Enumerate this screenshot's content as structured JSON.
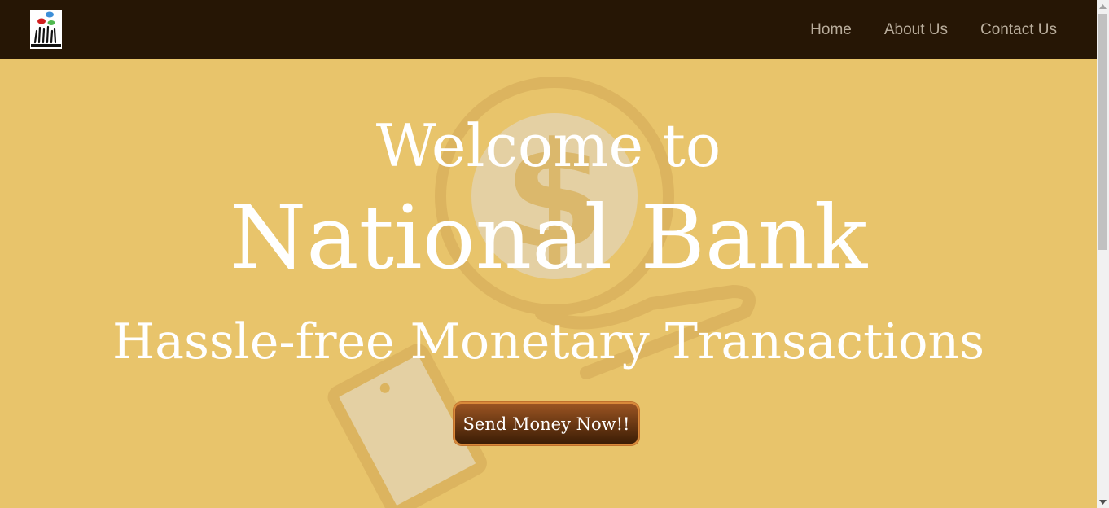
{
  "navbar": {
    "links": [
      "Home",
      "About Us",
      "Contact Us"
    ]
  },
  "hero": {
    "line1": "Welcome to",
    "line2": "National Bank",
    "line3": "Hassle-free Monetary Transactions",
    "cta_label": "Send Money Now!!"
  },
  "colors": {
    "navbar_bg": "#261605",
    "hero_bg": "#e8c46b",
    "nav_link": "#b9ad9c",
    "button_top": "#9a5422",
    "button_bottom": "#3c1d05",
    "button_border": "#d9893a"
  },
  "icons": {
    "logo": "hands-speech-bubbles-logo",
    "background": "hand-holding-dollar-coin-icon"
  }
}
